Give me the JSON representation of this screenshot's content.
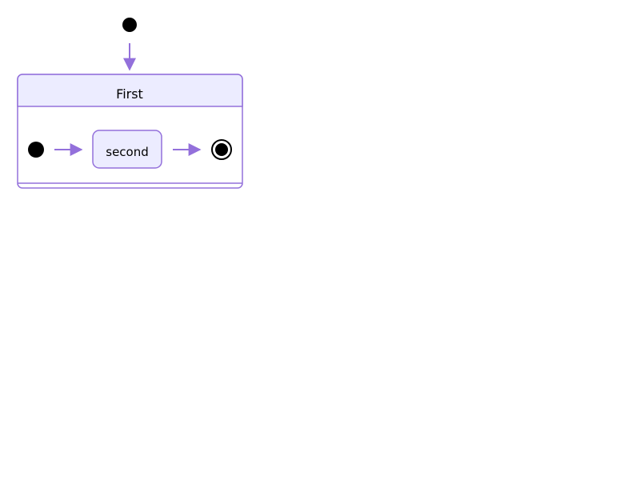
{
  "diagram": {
    "type": "state",
    "composite_state": {
      "label": "First"
    },
    "inner_state": {
      "label": "second"
    },
    "transitions": [
      {
        "from": "start",
        "to": "First"
      },
      {
        "from": "inner-start",
        "to": "second"
      },
      {
        "from": "second",
        "to": "inner-end"
      }
    ]
  },
  "colors": {
    "stroke": "#9370db",
    "fill": "#ececff",
    "node_dot": "#000000",
    "background": "#ffffff"
  }
}
